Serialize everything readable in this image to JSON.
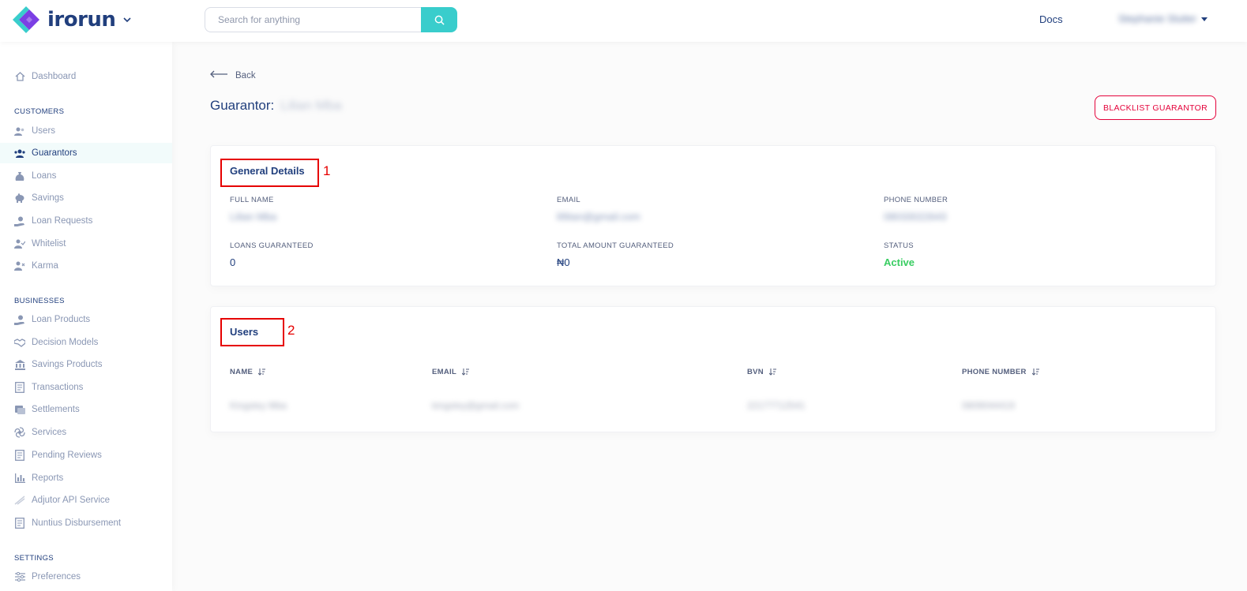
{
  "topbar": {
    "logo_text": "irorun",
    "search_placeholder": "Search for anything",
    "docs_label": "Docs",
    "user_name": "Stephanie Sluiter"
  },
  "sidebar": {
    "dashboard": "Dashboard",
    "customers_title": "CUSTOMERS",
    "customers": [
      "Users",
      "Guarantors",
      "Loans",
      "Savings",
      "Loan Requests",
      "Whitelist",
      "Karma"
    ],
    "businesses_title": "BUSINESSES",
    "businesses": [
      "Loan Products",
      "Decision Models",
      "Savings Products",
      "Transactions",
      "Settlements",
      "Services",
      "Pending Reviews",
      "Reports",
      "Adjutor API Service",
      "Nuntius Disbursement"
    ],
    "settings_title": "SETTINGS",
    "settings": [
      "Preferences"
    ],
    "active_item": "Guarantors"
  },
  "main": {
    "back_label": "Back",
    "title_prefix": "Guarantor:",
    "guarantor_name": "Lilian Mba",
    "blacklist_label": "BLACKLIST GUARANTOR"
  },
  "general": {
    "title": "General Details",
    "annotation": "1",
    "full_name_label": "FULL NAME",
    "full_name": "Lilian Mba",
    "email_label": "EMAIL",
    "email": "lil9ian@gmail.com",
    "phone_label": "PHONE NUMBER",
    "phone": "08033022643",
    "loans_label": "LOANS GUARANTEED",
    "loans": "0",
    "amount_label": "TOTAL AMOUNT GUARANTEED",
    "amount": "₦0",
    "status_label": "STATUS",
    "status": "Active"
  },
  "users": {
    "title": "Users",
    "annotation": "2",
    "columns": [
      "NAME",
      "EMAIL",
      "BVN",
      "PHONE NUMBER"
    ],
    "rows": [
      {
        "name": "Kingsley Mba",
        "email": "kingsley@gmail.com",
        "bvn": "22177712541",
        "phone": "0809044419"
      }
    ]
  },
  "colors": {
    "primary": "#213f7d",
    "accent": "#39cdcc",
    "danger": "#e4033b",
    "success": "#39cd62",
    "annotation": "#e60000"
  }
}
